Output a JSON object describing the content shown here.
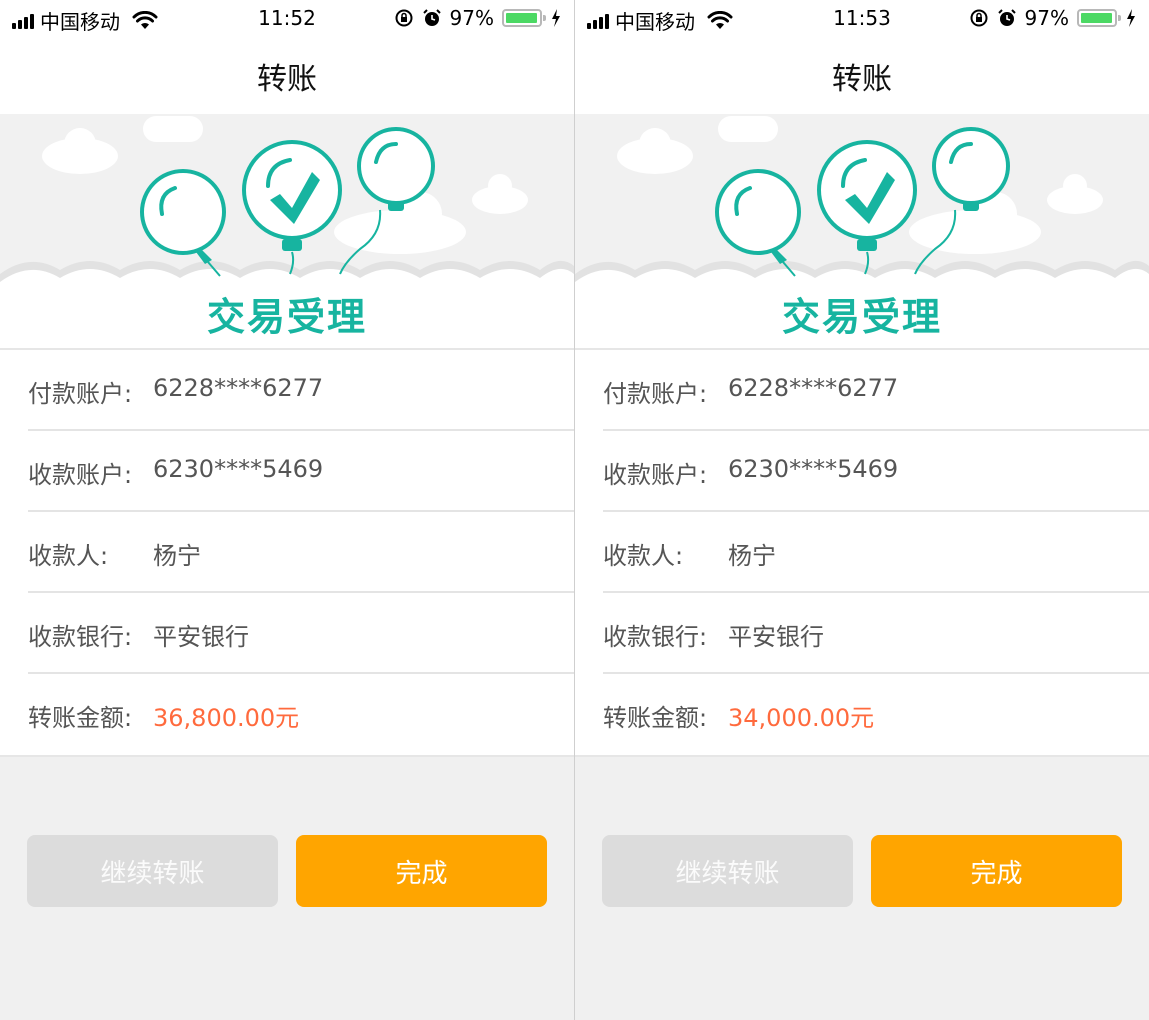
{
  "screens": [
    {
      "status": {
        "carrier": "中国移动",
        "time": "11:52",
        "battery": "97%"
      },
      "nav_title": "转账",
      "banner_text": "交易受理",
      "rows": [
        {
          "label": "付款账户:",
          "value": "6228****6277"
        },
        {
          "label": "收款账户:",
          "value": "6230****5469"
        },
        {
          "label": "收款人:",
          "value": "杨宁"
        },
        {
          "label": "收款银行:",
          "value": "平安银行"
        },
        {
          "label": "转账金额:",
          "value": "36,800.00元"
        }
      ],
      "buttons": {
        "continue": "继续转账",
        "done": "完成"
      }
    },
    {
      "status": {
        "carrier": "中国移动",
        "time": "11:53",
        "battery": "97%"
      },
      "nav_title": "转账",
      "banner_text": "交易受理",
      "rows": [
        {
          "label": "付款账户:",
          "value": "6228****6277"
        },
        {
          "label": "收款账户:",
          "value": "6230****5469"
        },
        {
          "label": "收款人:",
          "value": "杨宁"
        },
        {
          "label": "收款银行:",
          "value": "平安银行"
        },
        {
          "label": "转账金额:",
          "value": "34,000.00元"
        }
      ],
      "buttons": {
        "continue": "继续转账",
        "done": "完成"
      }
    }
  ],
  "colors": {
    "accent": "#17b4a0",
    "amount": "#ff6a3d",
    "primary_button": "#ffa500",
    "secondary_button": "#dcdcdc",
    "battery": "#4cd964"
  },
  "icons": [
    "signal-icon",
    "wifi-icon",
    "rotation-lock-icon",
    "alarm-icon",
    "battery-icon",
    "charging-icon",
    "balloon-icon",
    "checkmark-icon",
    "cloud-icon"
  ]
}
